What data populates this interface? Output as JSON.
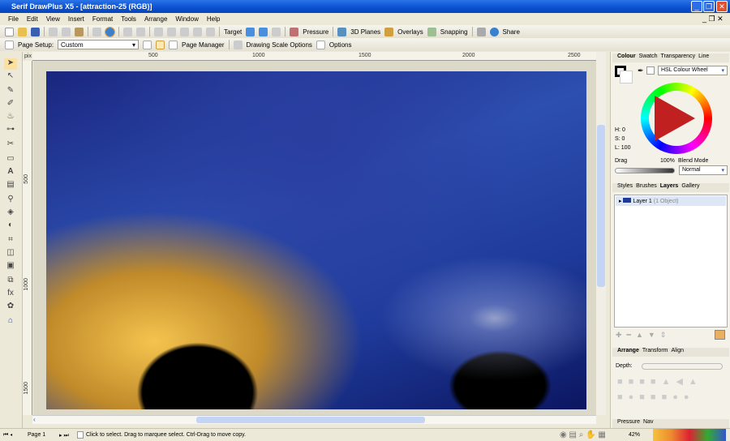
{
  "window": {
    "title": "Serif DrawPlus X5 - [attraction-25 (RGB)]"
  },
  "menu": [
    "File",
    "Edit",
    "View",
    "Insert",
    "Format",
    "Tools",
    "Arrange",
    "Window",
    "Help"
  ],
  "toolbar": {
    "target": "Target",
    "pressure": "Pressure",
    "planes": "3D Planes",
    "overlays": "Overlays",
    "snapping": "Snapping",
    "share": "Share"
  },
  "context_bar": {
    "page_setup_label": "Page Setup:",
    "page_setup_value": "Custom",
    "page_manager": "Page Manager",
    "drawing_scale": "Drawing Scale Options",
    "options": "Options"
  },
  "ruler": {
    "unit": "pix",
    "h_ticks": [
      "500",
      "1000",
      "1500",
      "2000",
      "2500"
    ],
    "v_ticks": [
      "500",
      "1000",
      "1500"
    ]
  },
  "colour_panel": {
    "tabs": [
      "Colour",
      "Swatch",
      "Transparency",
      "Line"
    ],
    "mode": "HSL Colour Wheel",
    "h": "H: 0",
    "s": "S: 0",
    "l": "L: 100",
    "drag": "Drag",
    "opacity": "100%",
    "blend_label": "Blend Mode",
    "blend_value": "Normal"
  },
  "layers_panel": {
    "tabs": [
      "Styles",
      "Brushes",
      "Layers",
      "Gallery"
    ],
    "layer_name": "Layer 1",
    "layer_info": "(1 Object)"
  },
  "arrange_panel": {
    "tabs": [
      "Arrange",
      "Transform",
      "Align"
    ],
    "depth": "Depth:"
  },
  "bottom_panel": {
    "tabs": [
      "Pressure",
      "Nav"
    ]
  },
  "status": {
    "page": "Page 1",
    "hint": "Click to select. Drag to marquee select. Ctrl-Drag to move copy.",
    "zoom": "42%"
  }
}
